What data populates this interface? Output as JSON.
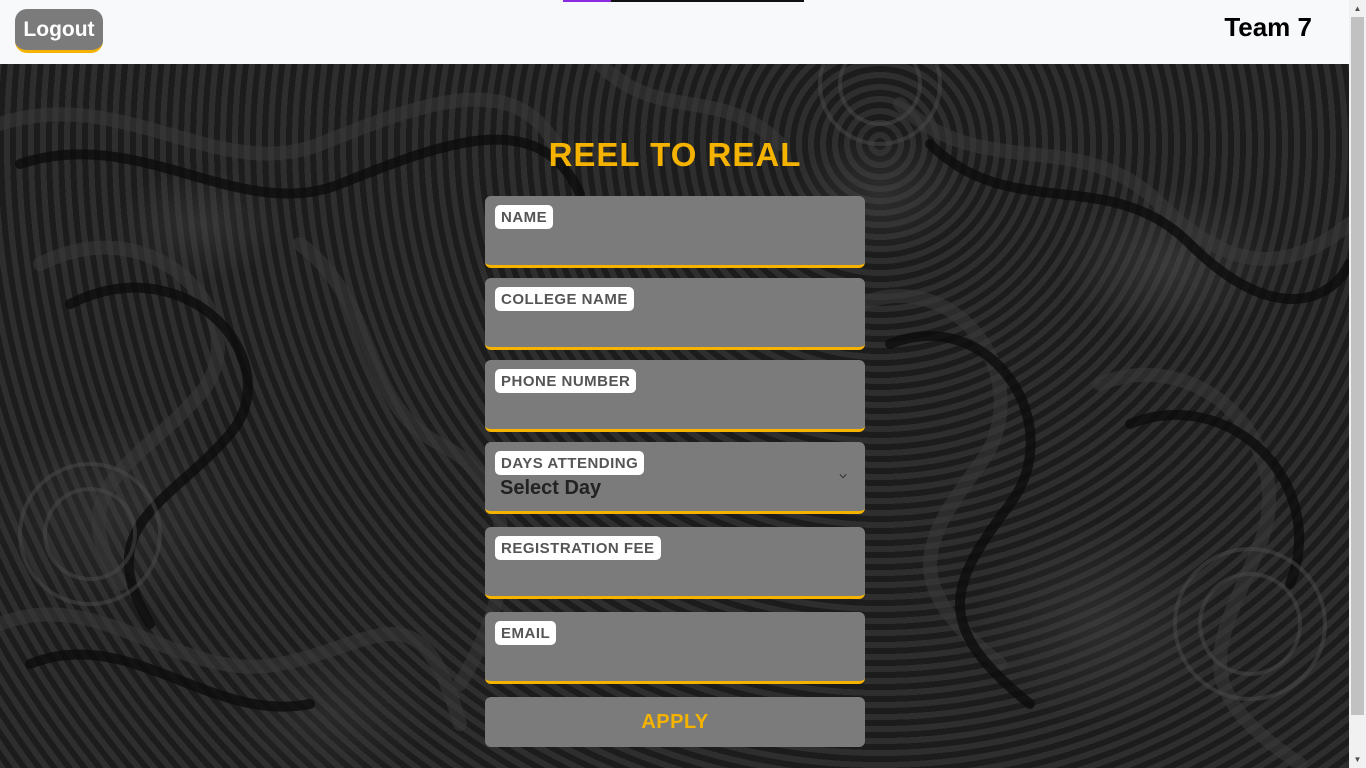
{
  "header": {
    "logout_label": "Logout",
    "team_label": "Team 7"
  },
  "form": {
    "title": "REEL TO REAL",
    "fields": [
      {
        "label": "NAME",
        "value": ""
      },
      {
        "label": "COLLEGE NAME",
        "value": ""
      },
      {
        "label": "PHONE NUMBER",
        "value": ""
      },
      {
        "label": "DAYS ATTENDING",
        "value": "Select Day"
      },
      {
        "label": "REGISTRATION FEE",
        "value": ""
      },
      {
        "label": "EMAIL",
        "value": ""
      }
    ],
    "apply_label": "APPLY"
  },
  "colors": {
    "accent": "#f5b300",
    "field_bg": "#7b7b7b",
    "page_bg": "#1a1a1a"
  },
  "icons": {
    "select": "chevron-down-icon"
  }
}
